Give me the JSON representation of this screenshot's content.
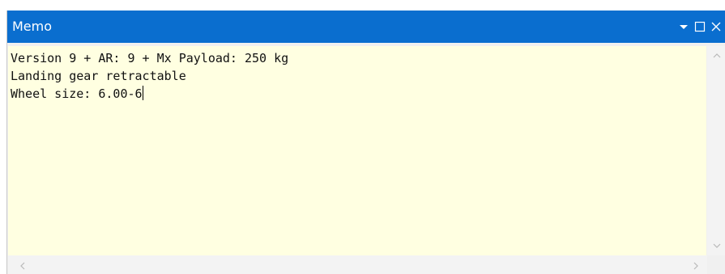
{
  "window": {
    "title": "Memo"
  },
  "titlebar_buttons": {
    "dropdown_icon": "chevron-down-icon",
    "maximize_icon": "maximize-icon",
    "close_icon": "close-icon"
  },
  "memo": {
    "text": "Version 9 + AR: 9 + Mx Payload: 250 kg\nLanding gear retractable\nWheel size: 6.00-6",
    "background_color": "#ffffe1"
  },
  "colors": {
    "titlebar": "#0a6ecf",
    "scrollbar_track": "#f3f3f3"
  },
  "scrollbars": {
    "up_icon": "scroll-up-icon",
    "down_icon": "scroll-down-icon",
    "left_icon": "scroll-left-icon",
    "right_icon": "scroll-right-icon"
  }
}
